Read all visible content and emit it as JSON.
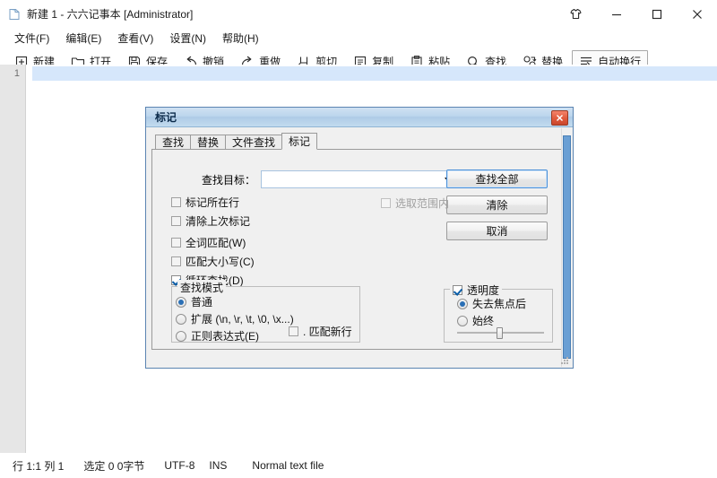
{
  "window": {
    "title": "新建 1 - 六六记事本 [Administrator]",
    "icon": "notepad-icon",
    "controls": [
      {
        "name": "skin-button",
        "glyph": "tshirt-icon"
      },
      {
        "name": "minimize-button",
        "glyph": "minimize-icon"
      },
      {
        "name": "maximize-button",
        "glyph": "maximize-icon"
      },
      {
        "name": "close-button",
        "glyph": "close-icon"
      }
    ]
  },
  "menubar": {
    "items": [
      {
        "name": "menu-file",
        "label": "文件(F)",
        "mnemonic": "F"
      },
      {
        "name": "menu-edit",
        "label": "编辑(E)",
        "mnemonic": "E"
      },
      {
        "name": "menu-view",
        "label": "查看(V)",
        "mnemonic": "V"
      },
      {
        "name": "menu-settings",
        "label": "设置(N)",
        "mnemonic": "N"
      },
      {
        "name": "menu-help",
        "label": "帮助(H)",
        "mnemonic": "H"
      }
    ]
  },
  "toolbar": {
    "items": [
      {
        "name": "toolbar-new",
        "label": "新建",
        "icon": "new-file-icon"
      },
      {
        "name": "toolbar-open",
        "label": "打开",
        "icon": "folder-open-icon"
      },
      {
        "name": "toolbar-save",
        "label": "保存",
        "icon": "floppy-save-icon"
      },
      {
        "name": "toolbar-undo",
        "label": "撤销",
        "icon": "undo-arrow-icon"
      },
      {
        "name": "toolbar-redo",
        "label": "重做",
        "icon": "redo-arrow-icon"
      },
      {
        "name": "toolbar-cut",
        "label": "剪切",
        "icon": "scissors-cut-icon"
      },
      {
        "name": "toolbar-copy",
        "label": "复制",
        "icon": "copy-icon"
      },
      {
        "name": "toolbar-paste",
        "label": "粘贴",
        "icon": "clipboard-paste-icon"
      },
      {
        "name": "toolbar-find",
        "label": "查找",
        "icon": "magnifier-search-icon"
      },
      {
        "name": "toolbar-replace",
        "label": "替换",
        "icon": "replace-swap-icon"
      },
      {
        "name": "toolbar-wordwrap",
        "label": "自动换行",
        "icon": "word-wrap-icon",
        "bordered": true
      }
    ]
  },
  "editor": {
    "line_numbers": [
      "1"
    ],
    "content": ""
  },
  "statusbar": {
    "segments": [
      {
        "name": "status-line-col",
        "text": "行 1:1  列 1"
      },
      {
        "name": "status-selection",
        "text": "选定 0   0字节"
      },
      {
        "name": "status-encoding",
        "text": "UTF-8"
      },
      {
        "name": "status-insert-mode",
        "text": "INS"
      },
      {
        "name": "status-filetype",
        "text": "Normal text file"
      }
    ]
  },
  "dialog": {
    "title": "标记",
    "close_label": "×",
    "tabs": [
      {
        "name": "tab-find",
        "label": "查找",
        "active": false
      },
      {
        "name": "tab-replace",
        "label": "替换",
        "active": false
      },
      {
        "name": "tab-find-in-files",
        "label": "文件查找",
        "active": false
      },
      {
        "name": "tab-mark",
        "label": "标记",
        "active": true
      }
    ],
    "find_field": {
      "label": "查找目标：",
      "value": "",
      "placeholder": ""
    },
    "buttons": [
      {
        "name": "find-all-button",
        "label": "查找全部",
        "default": true
      },
      {
        "name": "clear-button",
        "label": "清除",
        "default": false
      },
      {
        "name": "cancel-button",
        "label": "取消",
        "default": false
      }
    ],
    "checkboxes": [
      {
        "name": "checkbox-mark-line",
        "label": "标记所在行",
        "checked": false,
        "disabled": false
      },
      {
        "name": "checkbox-clear-previous-marks",
        "label": "清除上次标记",
        "checked": false,
        "disabled": false
      },
      {
        "name": "checkbox-whole-word",
        "label": "全词匹配(W)",
        "mnemonic": "W",
        "checked": false,
        "disabled": false
      },
      {
        "name": "checkbox-match-case",
        "label": "匹配大小写(C)",
        "mnemonic": "C",
        "checked": false,
        "disabled": false
      },
      {
        "name": "checkbox-wrap-around",
        "label": "循环查找(D)",
        "mnemonic": "D",
        "checked": true,
        "disabled": false
      }
    ],
    "in_selection": {
      "name": "checkbox-in-selection",
      "label": "选取范围内",
      "checked": false,
      "disabled": true
    },
    "search_mode": {
      "title": "查找模式",
      "options": [
        {
          "name": "radio-normal",
          "label": "普通",
          "selected": true
        },
        {
          "name": "radio-extended",
          "label": "扩展 (\\n, \\r, \\t, \\0, \\x...)",
          "selected": false
        },
        {
          "name": "radio-regex",
          "label": "正则表达式(E)",
          "mnemonic": "E",
          "selected": false
        }
      ],
      "newline_checkbox": {
        "name": "checkbox-match-newline",
        "label": ". 匹配新行",
        "checked": false
      }
    },
    "transparency": {
      "title": "透明度",
      "enabled": true,
      "options": [
        {
          "name": "radio-on-losing-focus",
          "label": "失去焦点后",
          "selected": true
        },
        {
          "name": "radio-always",
          "label": "始终",
          "selected": false
        }
      ],
      "slider_value": 46
    }
  },
  "colors": {
    "accent": "#4a90d9",
    "dialog_titlebar": "#bcd6ed",
    "close_red": "#e05a3c",
    "current_line": "#d6e7fb",
    "gutter": "#e6e6e6",
    "dialog_bg": "#f0f0f0"
  }
}
